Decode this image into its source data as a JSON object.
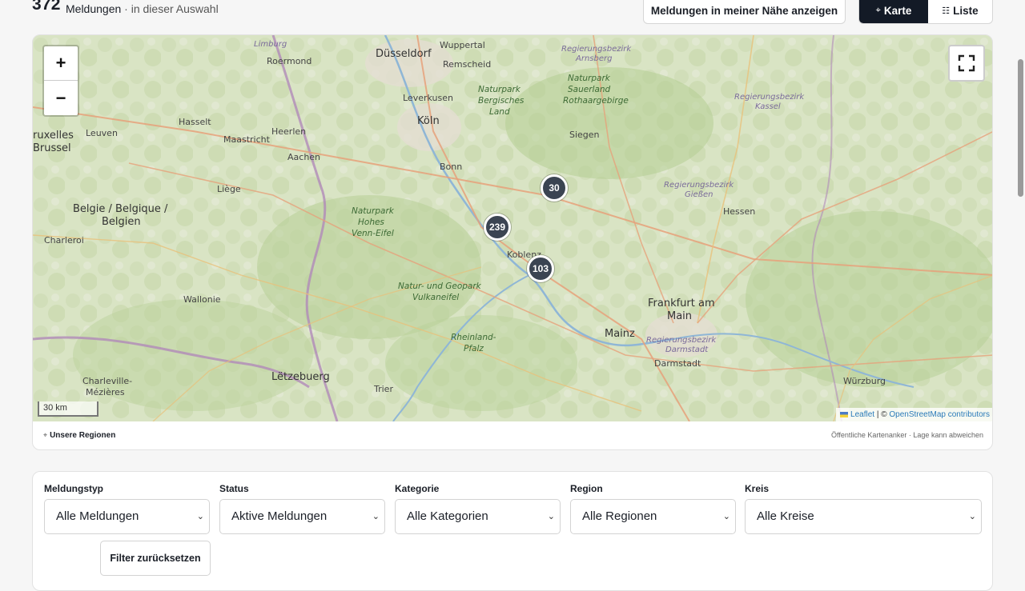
{
  "header": {
    "count": "372",
    "count_label": "Meldungen",
    "count_sub": "· in dieser Auswahl",
    "near_button": "Meldungen in meiner Nähe anzeigen",
    "view_map": "Karte",
    "view_list": "Liste"
  },
  "map": {
    "zoom_in": "+",
    "zoom_out": "−",
    "scale": "30 km",
    "attribution_leaflet": "Leaflet",
    "attribution_sep": " | © ",
    "attribution_osm": "OpenStreetMap contributors",
    "clusters": [
      {
        "label": "30"
      },
      {
        "label": "239"
      },
      {
        "label": "103"
      }
    ],
    "places": {
      "duesseldorf": "Düsseldorf",
      "wuppertal": "Wuppertal",
      "remscheid": "Remscheid",
      "leverkusen": "Leverkusen",
      "koeln": "Köln",
      "roermond": "Roermond",
      "limburg": "Limburg",
      "hasselt": "Hasselt",
      "heerlen": "Heerlen",
      "maastricht": "Maastricht",
      "aachen": "Aachen",
      "leuven": "Leuven",
      "bruxelles1": "ruxelles",
      "bruxelles2": "Brussel",
      "liege": "Liège",
      "belgie1": "Belgie / Belgique /",
      "belgie2": "Belgien",
      "charleroi": "Charleroi",
      "bonn": "Bonn",
      "siegen": "Siegen",
      "koblenz": "Koblenz",
      "frankfurt1": "Frankfurt am",
      "frankfurt2": "Main",
      "mainz": "Mainz",
      "darmstadt": "Darmstadt",
      "hessen": "Hessen",
      "letzebuerg": "Lëtzebuerg",
      "trier": "Trier",
      "wallonie": "Wallonie",
      "charleville": "Charleville-",
      "mezieres": "Mézières",
      "wuerzburg": "Würzburg",
      "rheinland_pfalz": "Rheinland-",
      "pfalz": "Pfalz",
      "np_bergisches": "Naturpark",
      "np_bergisches2": "Bergisches",
      "np_bergisches3": "Land",
      "np_sauerland": "Naturpark",
      "np_sauerland2": "Sauerland",
      "np_sauerland3": "Rothaargebirge",
      "np_hohes": "Naturpark",
      "np_hohes2": "Hohes",
      "np_hohes3": "Venn-Eifel",
      "np_vulkaneifel": "Natur- und Geopark",
      "np_vulkaneifel2": "Vulkaneifel",
      "rb_arnsberg": "Regierungsbezirk",
      "rb_arnsberg2": "Arnsberg",
      "rb_kassel": "Regierungsbezirk",
      "rb_kassel2": "Kassel",
      "rb_giessen": "Regierungsbezirk",
      "rb_giessen2": "Gießen",
      "rb_darmstadt": "Regierungsbezirk",
      "rb_darmstadt2": "Darmstadt"
    }
  },
  "map_footer": {
    "regions_link": "Unsere Regionen",
    "note": "Öffentliche Kartenanker · Lage kann abweichen"
  },
  "filters": {
    "type_label": "Meldungstyp",
    "type_value": "Alle Meldungen",
    "status_label": "Status",
    "status_value": "Aktive Meldungen",
    "category_label": "Kategorie",
    "category_value": "Alle Kategorien",
    "region_label": "Region",
    "region_value": "Alle Regionen",
    "district_label": "Kreis",
    "district_value": "Alle Kreise",
    "reset_button": "Filter zurücksetzen"
  }
}
